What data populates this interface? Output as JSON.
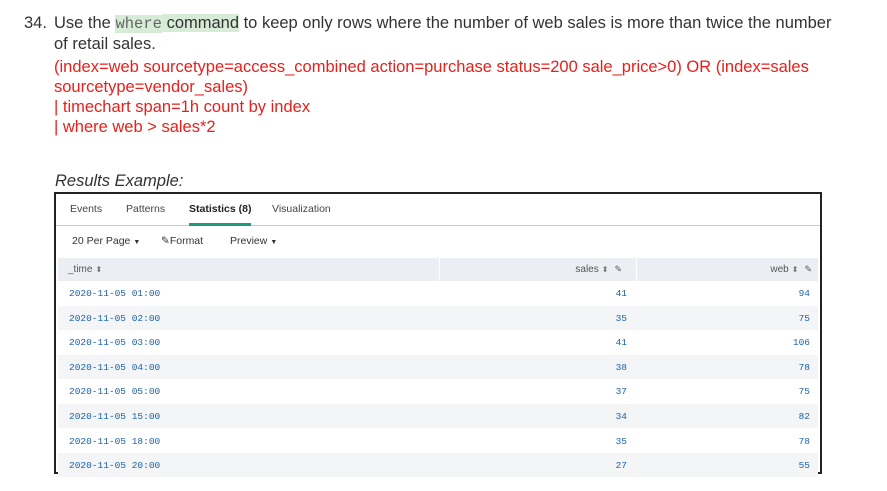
{
  "instruction": {
    "number": "34.",
    "pre": "Use the ",
    "code": "where",
    "space": " ",
    "command_word": "command",
    "post": " to keep only rows where the number of web sales is more than twice the number of retail sales."
  },
  "search_lines": [
    "(index=web sourcetype=access_combined action=purchase status=200 sale_price>0) OR (index=sales sourcetype=vendor_sales)",
    "| timechart span=1h count by index",
    "| where web > sales*2"
  ],
  "results_label": "Results Example:",
  "tabs": [
    "Events",
    "Patterns",
    "Statistics (8)",
    "Visualization"
  ],
  "toolbar": {
    "per_page": "20 Per Page",
    "format": "Format",
    "preview": "Preview"
  },
  "columns": [
    "_time",
    "sales",
    "web"
  ],
  "rows": [
    [
      "2020-11-05 01:00",
      "41",
      "94"
    ],
    [
      "2020-11-05 02:00",
      "35",
      "75"
    ],
    [
      "2020-11-05 03:00",
      "41",
      "106"
    ],
    [
      "2020-11-05 04:00",
      "38",
      "78"
    ],
    [
      "2020-11-05 05:00",
      "37",
      "75"
    ],
    [
      "2020-11-05 15:00",
      "34",
      "82"
    ],
    [
      "2020-11-05 18:00",
      "35",
      "78"
    ],
    [
      "2020-11-05 20:00",
      "27",
      "55"
    ]
  ],
  "icons": {
    "sort": "sort-icon",
    "edit": "pencil-icon",
    "dropdown": "caret-down-icon"
  },
  "colors": {
    "search_text": "#e8201b",
    "highlight": "#d6ecd6",
    "active_tab": "#1a9c7f",
    "cell_text": "#1d62a8"
  }
}
